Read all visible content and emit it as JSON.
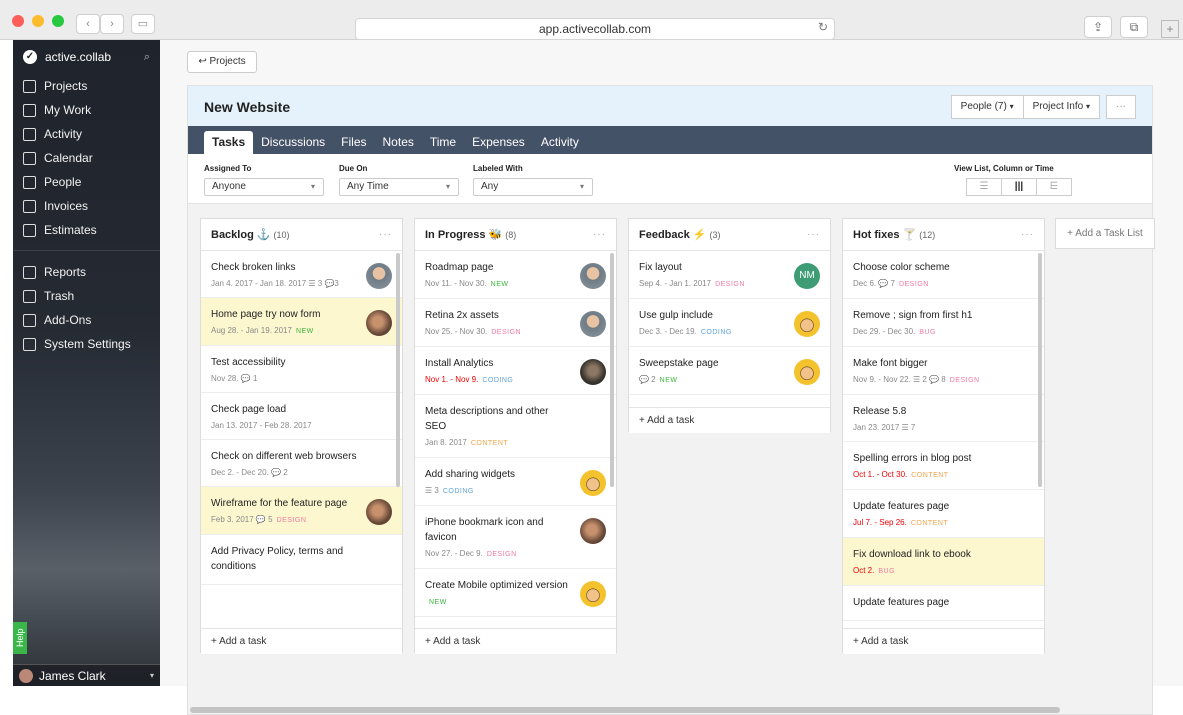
{
  "browser": {
    "url": "app.activecollab.com"
  },
  "sidebar": {
    "brand": "active.collab",
    "items": [
      {
        "label": "Projects",
        "icon": "folder-icon"
      },
      {
        "label": "My Work",
        "icon": "check-circle-icon"
      },
      {
        "label": "Activity",
        "icon": "activity-icon"
      },
      {
        "label": "Calendar",
        "icon": "calendar-icon"
      },
      {
        "label": "People",
        "icon": "people-icon"
      },
      {
        "label": "Invoices",
        "icon": "invoice-icon"
      },
      {
        "label": "Estimates",
        "icon": "estimate-icon"
      }
    ],
    "items2": [
      {
        "label": "Reports",
        "icon": "reports-icon"
      },
      {
        "label": "Trash",
        "icon": "trash-icon"
      },
      {
        "label": "Add-Ons",
        "icon": "addons-icon"
      },
      {
        "label": "System Settings",
        "icon": "settings-icon"
      }
    ],
    "help": "Help",
    "user": "James Clark"
  },
  "main": {
    "back_button": "↩ Projects",
    "project": {
      "title": "New Website",
      "people_btn": "People (7)",
      "info_btn": "Project Info",
      "more_btn": "···"
    },
    "tabs": [
      "Tasks",
      "Discussions",
      "Files",
      "Notes",
      "Time",
      "Expenses",
      "Activity"
    ],
    "filters": {
      "assigned_label": "Assigned To",
      "assigned_value": "Anyone",
      "due_label": "Due On",
      "due_value": "Any Time",
      "labeled_label": "Labeled With",
      "labeled_value": "Any",
      "view_label": "View List, Column or Time"
    },
    "add_task_list": "+ Add a Task List",
    "add_task": "+ Add a task"
  },
  "lists": [
    {
      "title": "Backlog ⚓",
      "count": "(10)",
      "tasks": [
        {
          "name": "Check broken links",
          "meta": "Jan 4. 2017 - Jan 18. 2017 ☰ 3 💬3",
          "label": "",
          "label_class": "",
          "avatar": "a1",
          "hl": false,
          "red": false
        },
        {
          "name": "Home page try now form",
          "meta": "Aug 28. - Jan 19. 2017",
          "label": "NEW",
          "label_class": "new",
          "avatar": "a2",
          "hl": true,
          "red": false
        },
        {
          "name": "Test accessibility",
          "meta": "Nov 28. 💬 1",
          "label": "",
          "label_class": "",
          "avatar": "",
          "hl": false,
          "red": false
        },
        {
          "name": "Check page load",
          "meta": "Jan 13. 2017 - Feb 28. 2017",
          "label": "",
          "label_class": "",
          "avatar": "",
          "hl": false,
          "red": false
        },
        {
          "name": "Check on different web browsers",
          "meta": "Dec 2. - Dec 20. 💬 2",
          "label": "",
          "label_class": "",
          "avatar": "",
          "hl": false,
          "red": false
        },
        {
          "name": "Wireframe for the feature page",
          "meta": "Feb 3. 2017 💬 5",
          "label": "DESIGN",
          "label_class": "design",
          "avatar": "a2",
          "hl": true,
          "red": false
        },
        {
          "name": "Add Privacy Policy, terms and conditions",
          "meta": "",
          "label": "",
          "label_class": "",
          "avatar": "",
          "hl": false,
          "red": false
        }
      ]
    },
    {
      "title": "In Progress 🐝",
      "count": "(8)",
      "tasks": [
        {
          "name": "Roadmap page",
          "meta": "Nov 11. - Nov 30.",
          "label": "NEW",
          "label_class": "new",
          "avatar": "a1",
          "hl": false,
          "red": false
        },
        {
          "name": "Retina 2x assets",
          "meta": "Nov 25. - Nov 30.",
          "label": "DESIGN",
          "label_class": "design",
          "avatar": "a1",
          "hl": false,
          "red": false
        },
        {
          "name": "Install Analytics",
          "meta": "Nov 1. - Nov 9.",
          "label": "CODING",
          "label_class": "coding",
          "avatar": "a3",
          "hl": false,
          "red": true
        },
        {
          "name": "Meta descriptions and other SEO",
          "meta": "Jan 8. 2017",
          "label": "CONTENT",
          "label_class": "content",
          "avatar": "",
          "hl": false,
          "red": false
        },
        {
          "name": "Add sharing widgets",
          "meta": "☰ 3",
          "label": "CODING",
          "label_class": "coding",
          "avatar": "a4",
          "hl": false,
          "red": false
        },
        {
          "name": "iPhone bookmark icon and favicon",
          "meta": "Nov 27. - Dec 9.",
          "label": "DESIGN",
          "label_class": "design",
          "avatar": "a2",
          "hl": false,
          "red": false
        },
        {
          "name": "Create Mobile optimized version",
          "meta": "",
          "label": "NEW",
          "label_class": "new",
          "avatar": "a4",
          "hl": false,
          "red": false
        }
      ]
    },
    {
      "title": "Feedback ⚡",
      "count": "(3)",
      "tasks": [
        {
          "name": "Fix layout",
          "meta": "Sep 4. - Jan 1. 2017",
          "label": "DESIGN",
          "label_class": "design",
          "avatar": "nm",
          "hl": false,
          "red": false
        },
        {
          "name": "Use gulp include",
          "meta": "Dec 3. - Dec 19.",
          "label": "CODING",
          "label_class": "coding",
          "avatar": "a4",
          "hl": false,
          "red": false
        },
        {
          "name": "Sweepstake page",
          "meta": "💬 2",
          "label": "NEW",
          "label_class": "new",
          "avatar": "a4",
          "hl": false,
          "red": false
        }
      ]
    },
    {
      "title": "Hot fixes 🍸",
      "count": "(12)",
      "tasks": [
        {
          "name": "Choose color scheme",
          "meta": "Dec 6. 💬 7",
          "label": "DESIGN",
          "label_class": "design",
          "avatar": "",
          "hl": false,
          "red": false
        },
        {
          "name": "Remove ; sign from first h1",
          "meta": "Dec 29. - Dec 30.",
          "label": "BUG",
          "label_class": "bug",
          "avatar": "",
          "hl": false,
          "red": false
        },
        {
          "name": "Make font bigger",
          "meta": "Nov 9. - Nov 22. ☰ 2 💬 8",
          "label": "DESIGN",
          "label_class": "design",
          "avatar": "",
          "hl": false,
          "red": false
        },
        {
          "name": "Release 5.8",
          "meta": "Jan 23. 2017 ☰ 7",
          "label": "",
          "label_class": "",
          "avatar": "",
          "hl": false,
          "red": false
        },
        {
          "name": "Spelling errors in blog post",
          "meta": "Oct 1. - Oct 30.",
          "label": "CONTENT",
          "label_class": "content",
          "avatar": "",
          "hl": false,
          "red": true
        },
        {
          "name": "Update features page",
          "meta": "Jul 7. - Sep 26.",
          "label": "CONTENT",
          "label_class": "content",
          "avatar": "",
          "hl": false,
          "red": true
        },
        {
          "name": "Fix download link to ebook",
          "meta": "Oct 2.",
          "label": "BUG",
          "label_class": "bug",
          "avatar": "",
          "hl": true,
          "red": true
        },
        {
          "name": "Update features page",
          "meta": "",
          "label": "",
          "label_class": "",
          "avatar": "",
          "hl": false,
          "red": false
        }
      ]
    }
  ],
  "nm_initials": "NM"
}
